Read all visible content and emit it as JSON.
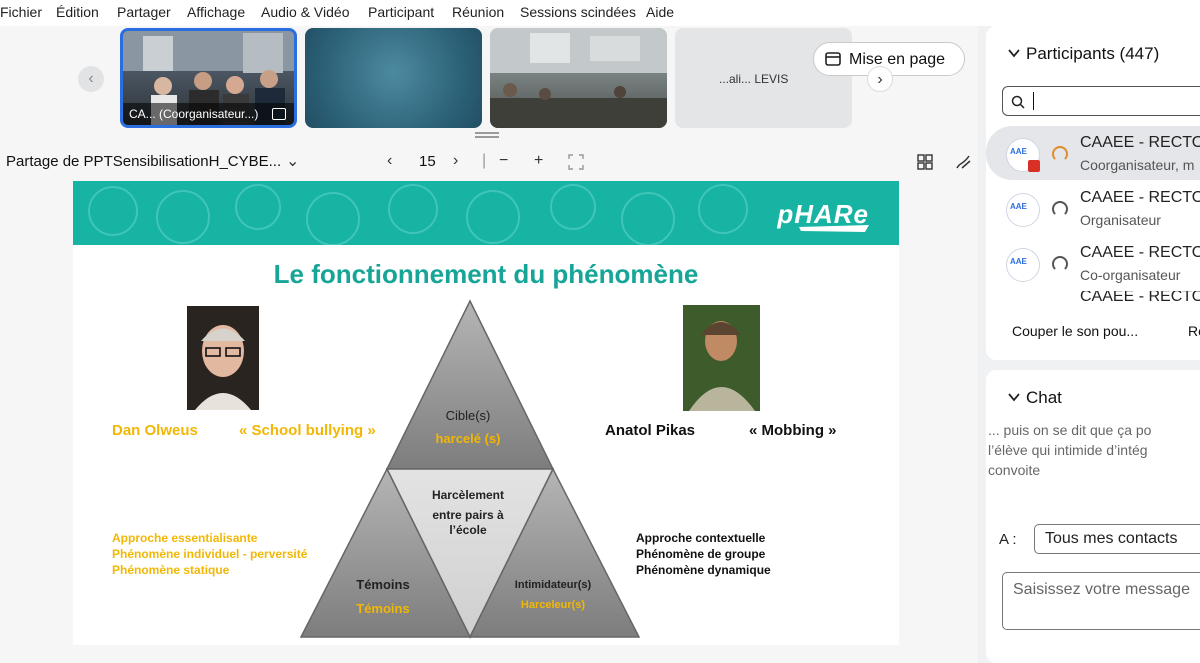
{
  "menu": [
    "Fichier",
    "Édition",
    "Partager",
    "Affichage",
    "Audio & Vidéo",
    "Participant",
    "Réunion",
    "Sessions scindées",
    "Aide"
  ],
  "thumbnails": {
    "first_label": "CA... (Coorganisateur...)",
    "fourth_label": "...ali... LEVIS"
  },
  "layout_button": "Mise en page",
  "share": {
    "title": "Partage de PPTSensibilisationH_CYBE...",
    "page": "15"
  },
  "slide": {
    "logo": "pHARe",
    "title": "Le fonctionnement du phénomène",
    "left_name": "Dan Olweus",
    "left_term": "« School bullying »",
    "right_name": "Anatol Pikas",
    "right_term": "« Mobbing »",
    "top_label": "Cible(s)",
    "top_sub": "harcelé (s)",
    "center_line1": "Harcèlement",
    "center_line2": "entre pairs à",
    "center_line3": "l’école",
    "bl_label": "Témoins",
    "bl_sub": "Témoins",
    "br_label": "Intimidateur(s)",
    "br_sub": "Harceleur(s)",
    "left_approach": [
      "Approche essentialisante",
      "Phénomène individuel - perversité",
      "Phénomène statique"
    ],
    "right_approach": [
      "Approche contextuelle",
      "Phénomène de groupe",
      "Phénomène dynamique"
    ]
  },
  "participants": {
    "header": "Participants (447)",
    "rows": [
      {
        "name": "CAAEE - RECTO",
        "role": "Coorganisateur, m"
      },
      {
        "name": "CAAEE - RECTO",
        "role": "Organisateur"
      },
      {
        "name": "CAAEE - RECTO",
        "role": "Co-organisateur"
      },
      {
        "name": "CAAEE - RECTO",
        "role": ""
      }
    ],
    "mute_all": "Couper le son pou...",
    "second_action": "Re"
  },
  "chat": {
    "header": "Chat",
    "messages": [
      "... puis on se dit que ça po",
      "l’élève qui intimide d’intég",
      "convoite"
    ],
    "to_label": "A :",
    "to_value": "Tous mes contacts",
    "input_placeholder": "Saisissez votre message"
  },
  "colors": {
    "accent": "#2b6ee0",
    "slide_teal": "#17b3a3",
    "slide_title": "#16a596",
    "slide_yellow": "#f2b705",
    "triangle_gray": "#8f8f8f"
  }
}
